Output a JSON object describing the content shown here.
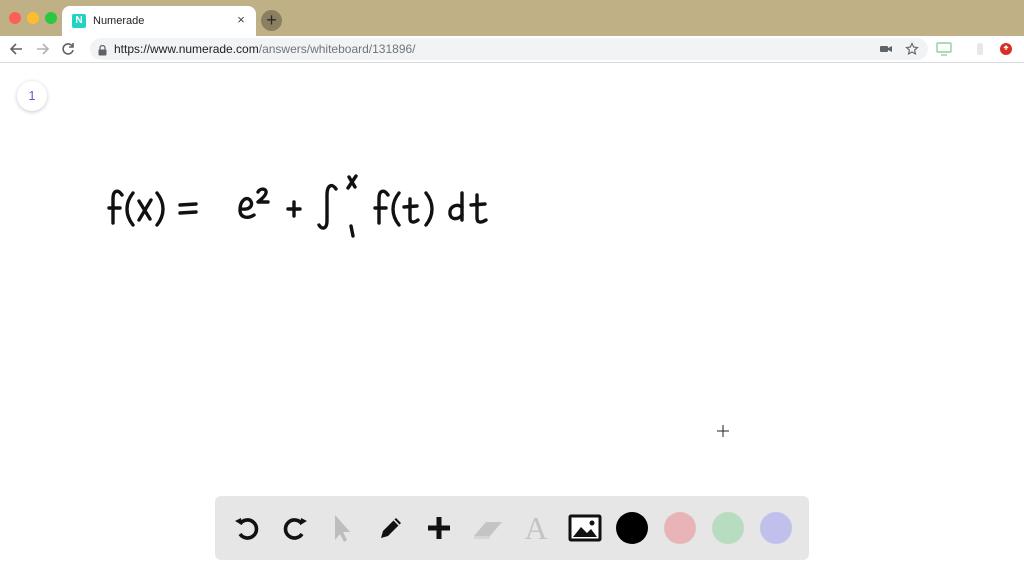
{
  "browser": {
    "tab": {
      "favicon": "N",
      "title": "Numerade",
      "close_glyph": "×"
    },
    "new_tab_glyph": "+",
    "address": {
      "host_part": "https://www.numerade.com",
      "path_part": "/answers/whiteboard/131896/"
    },
    "icons": [
      "back-arrow-icon",
      "forward-arrow-icon",
      "reload-icon",
      "lock-icon",
      "camera-icon",
      "star-icon",
      "cast-icon",
      "extension-icon",
      "profile-icon"
    ]
  },
  "whiteboard": {
    "page_number": "1",
    "handwritten_equation": "f(x) = e^2 + ∫_1^x f(t) dt"
  },
  "dock": {
    "tools": [
      "undo-icon",
      "redo-icon",
      "pointer-icon",
      "pen-icon",
      "add-icon",
      "eraser-icon",
      "text-icon",
      "image-icon"
    ],
    "text_tool_glyph": "A",
    "colors": [
      "#000000",
      "#e8b4b8",
      "#b8dcc0",
      "#c0c0ee"
    ]
  }
}
